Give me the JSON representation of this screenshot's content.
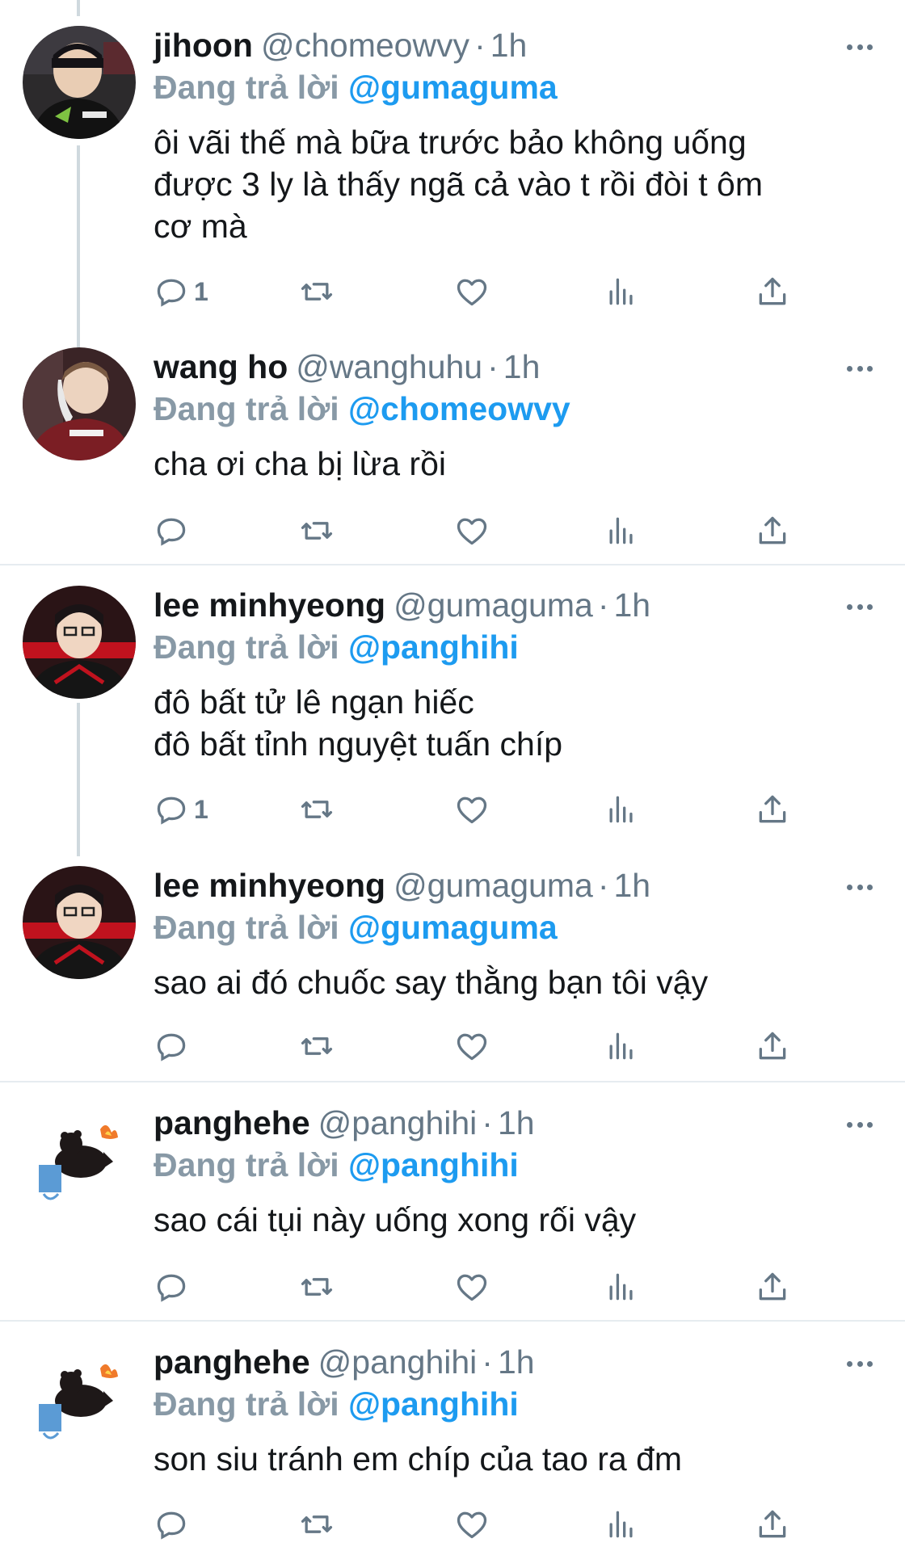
{
  "tweets": [
    {
      "name": "jihoon",
      "handle": "@chomeowvy",
      "time": "1h",
      "reply_label": "Đang trả lời",
      "reply_to": "@gumaguma",
      "text": "ôi vãi thế mà bữa trước bảo không uống\nđược 3 ly là thấy ngã cả vào t rồi đòi t ôm\ncơ mà",
      "reply_count": "1"
    },
    {
      "name": "wang ho",
      "handle": "@wanghuhu",
      "time": "1h",
      "reply_label": "Đang trả lời",
      "reply_to": "@chomeowvy",
      "text": "cha ơi cha bị lừa rồi",
      "reply_count": ""
    },
    {
      "name": "lee minhyeong",
      "handle": "@gumaguma",
      "time": "1h",
      "reply_label": "Đang trả lời",
      "reply_to": "@panghihi",
      "text": "đô bất tử lê ngạn hiếc\nđô bất tỉnh nguyệt tuấn chíp",
      "reply_count": "1"
    },
    {
      "name": "lee minhyeong",
      "handle": "@gumaguma",
      "time": "1h",
      "reply_label": "Đang trả lời",
      "reply_to": "@gumaguma",
      "text": "sao ai đó chuốc say thằng bạn tôi vậy",
      "reply_count": ""
    },
    {
      "name": "panghehe",
      "handle": "@panghihi",
      "time": "1h",
      "reply_label": "Đang trả lời",
      "reply_to": "@panghihi",
      "text": "sao cái tụi này uống xong rối vậy",
      "reply_count": ""
    },
    {
      "name": "panghehe",
      "handle": "@panghihi",
      "time": "1h",
      "reply_label": "Đang trả lời",
      "reply_to": "@panghihi",
      "text": "son siu tránh em chíp của tao ra đm",
      "reply_count": ""
    }
  ],
  "icons": [
    "reply-icon",
    "retweet-icon",
    "like-icon",
    "analytics-icon",
    "share-icon",
    "more-icon"
  ],
  "colors": {
    "accent": "#1d9bf0",
    "muted": "#657786",
    "reply_label": "#8899a6",
    "text": "#14171a",
    "divider": "#e6ecf0"
  }
}
